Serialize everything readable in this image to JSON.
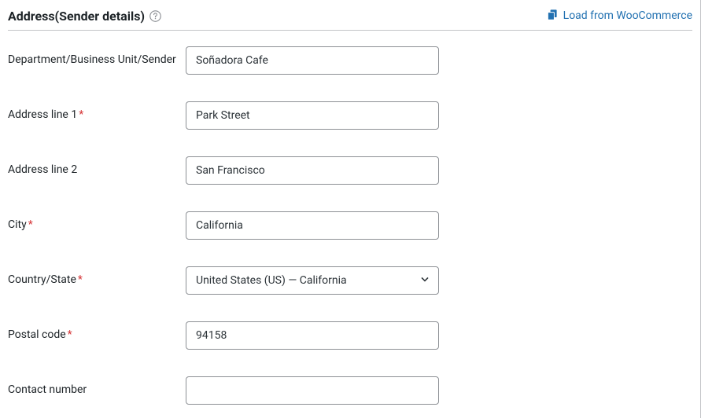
{
  "section": {
    "title": "Address(Sender details)",
    "load_link_text": "Load from WooCommerce"
  },
  "fields": {
    "business": {
      "label": "Department/Business Unit/Sender",
      "required": false,
      "value": "Soñadora Cafe"
    },
    "address1": {
      "label": "Address line 1",
      "required": true,
      "value": "Park Street"
    },
    "address2": {
      "label": "Address line 2",
      "required": false,
      "value": "San Francisco"
    },
    "city": {
      "label": "City",
      "required": true,
      "value": "California"
    },
    "country_state": {
      "label": "Country/State",
      "required": true,
      "value": "United States (US) — California"
    },
    "postal": {
      "label": "Postal code",
      "required": true,
      "value": "94158"
    },
    "contact": {
      "label": "Contact number",
      "required": false,
      "value": ""
    }
  }
}
